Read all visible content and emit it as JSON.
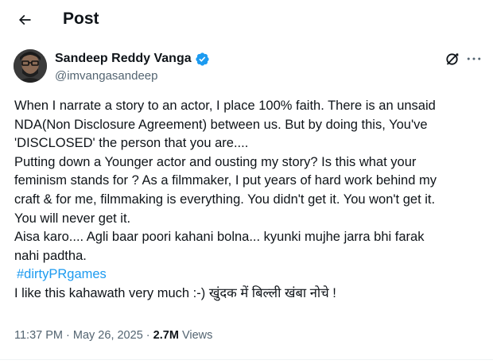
{
  "header": {
    "title": "Post",
    "back_icon": "arrow-left-icon"
  },
  "author": {
    "name": "Sandeep Reddy Vanga",
    "handle": "@imvangasandeep",
    "verified": true,
    "verified_color": "#1d9bf0"
  },
  "actions": {
    "grok_icon": "grok-icon",
    "more_icon": "more-horizontal-icon"
  },
  "post": {
    "lines": [
      "When I narrate a story to an actor, I place 100% faith. There is an unsaid",
      "NDA(Non Disclosure Agreement) between us. But by doing this, You've",
      "'DISCLOSED' the person that you are....",
      "Putting down a Younger actor and ousting my story?  Is this what your",
      "feminism stands for ? As a filmmaker, I put years of hard work behind my",
      "craft & for me, filmmaking is everything. You didn't get it. You won't get it.",
      "You will never get it.",
      "Aisa karo.... Agli baar poori kahani bolna... kyunki mujhe jarra bhi farak",
      "nahi padtha."
    ],
    "hashtag": "#dirtyPRgames",
    "last_line": "I like this kahawath very much :-) खुंदक में बिल्ली खंबा नोचे !"
  },
  "meta": {
    "time": "11:37 PM",
    "separator": " · ",
    "date": "May 26, 2025",
    "views_count": "2.7M",
    "views_label": "Views"
  },
  "colors": {
    "text": "#0f1419",
    "secondary": "#536471",
    "link": "#1d9bf0"
  }
}
